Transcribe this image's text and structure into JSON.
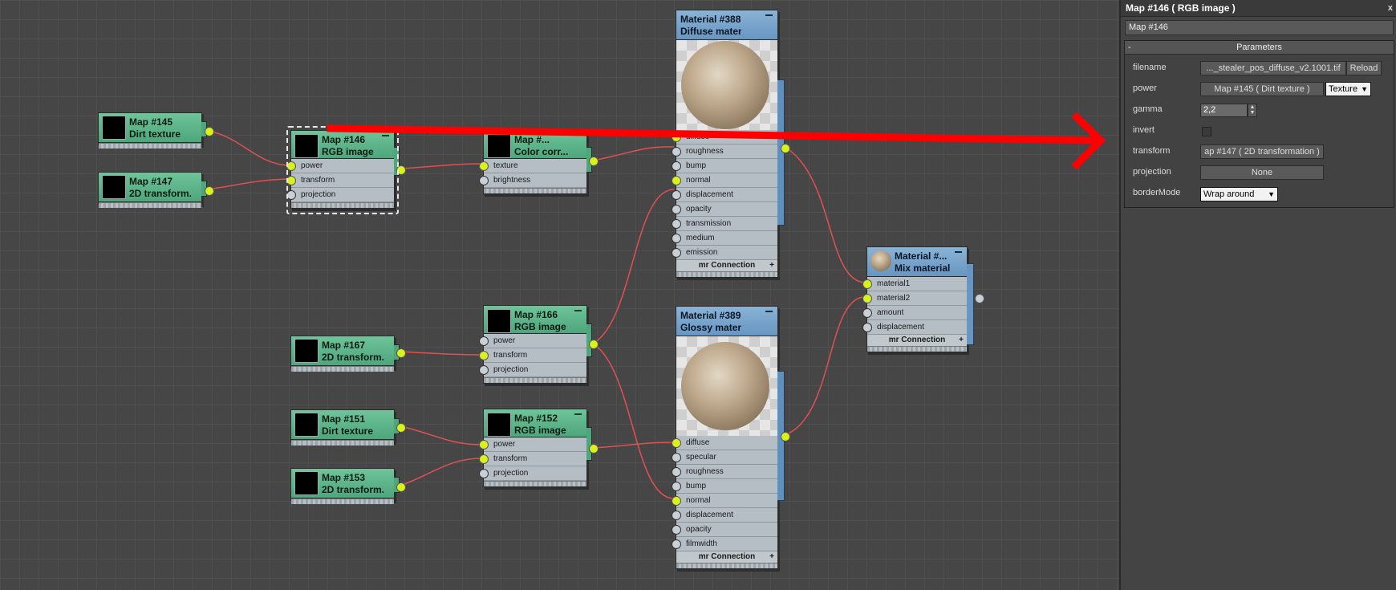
{
  "nodes": {
    "map145": {
      "t1": "Map #145",
      "t2": "Dirt texture"
    },
    "map147": {
      "t1": "Map #147",
      "t2": "2D transform..."
    },
    "map146": {
      "t1": "Map #146",
      "t2": "RGB image",
      "ports": [
        "power",
        "transform",
        "projection"
      ]
    },
    "colorcorr": {
      "t1": "Map #...",
      "t2": "Color corr...",
      "ports": [
        "texture",
        "brightness"
      ]
    },
    "map167": {
      "t1": "Map #167",
      "t2": "2D transform..."
    },
    "map166": {
      "t1": "Map #166",
      "t2": "RGB image",
      "ports": [
        "power",
        "transform",
        "projection"
      ]
    },
    "map151": {
      "t1": "Map #151",
      "t2": "Dirt texture"
    },
    "map153": {
      "t1": "Map #153",
      "t2": "2D transform..."
    },
    "map152": {
      "t1": "Map #152",
      "t2": "RGB image",
      "ports": [
        "power",
        "transform",
        "projection"
      ]
    },
    "mat388": {
      "t1": "Material #388",
      "t2": "Diffuse material",
      "ports": [
        "diffuse",
        "roughness",
        "bump",
        "normal",
        "displacement",
        "opacity",
        "transmission",
        "medium",
        "emission"
      ],
      "conn": "mr Connection"
    },
    "mat389": {
      "t1": "Material #389",
      "t2": "Glossy material",
      "ports": [
        "diffuse",
        "specular",
        "roughness",
        "bump",
        "normal",
        "displacement",
        "opacity",
        "filmwidth"
      ],
      "conn": "mr Connection"
    },
    "mix": {
      "t1": "Material #...",
      "t2": "Mix material",
      "ports": [
        "material1",
        "material2",
        "amount",
        "displacement"
      ],
      "conn": "mr Connection"
    }
  },
  "panel": {
    "title": "Map #146  ( RGB image )",
    "close": "x",
    "name": "Map #146",
    "rollout": "Parameters",
    "rollout_toggle": "-",
    "filename_label": "filename",
    "filename_value": "..._stealer_pos_diffuse_v2.1001.tif",
    "reload": "Reload",
    "power_label": "power",
    "power_value": "Map #145  ( Dirt texture )",
    "power_type": "Texture",
    "gamma_label": "gamma",
    "gamma_value": "2,2",
    "invert_label": "invert",
    "transform_label": "transform",
    "transform_value": "ap #147  ( 2D transformation )",
    "projection_label": "projection",
    "projection_value": "None",
    "bordermode_label": "borderMode",
    "bordermode_value": "Wrap around"
  },
  "colors": {
    "arrow": "#ff0000",
    "wire": "#e05050",
    "map_header": "#5cb388",
    "material_header": "#7aa6cf",
    "port_on": "#d8f21a"
  }
}
